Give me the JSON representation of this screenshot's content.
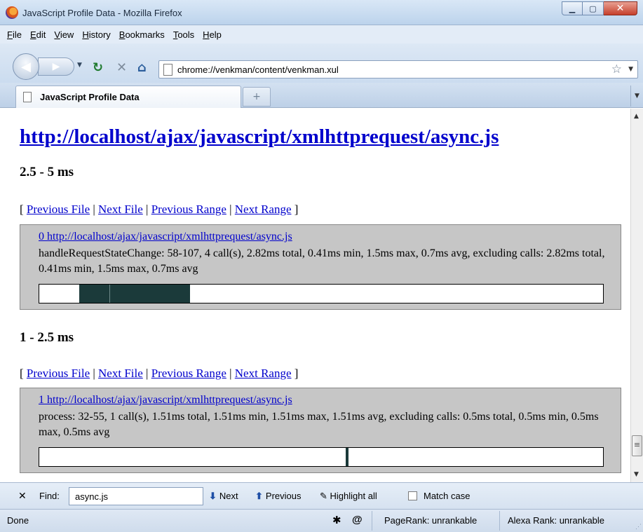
{
  "window": {
    "title": "JavaScript Profile Data - Mozilla Firefox"
  },
  "menu": [
    "File",
    "Edit",
    "View",
    "History",
    "Bookmarks",
    "Tools",
    "Help"
  ],
  "nav": {
    "url": "chrome://venkman/content/venkman.xul"
  },
  "tabs": [
    {
      "label": "JavaScript Profile Data"
    }
  ],
  "page": {
    "file_link": "http://localhost/ajax/javascript/xmlhttprequest/async.js",
    "nav_links": [
      "Previous File",
      "Next File",
      "Previous Range",
      "Next Range"
    ],
    "sections": [
      {
        "range": "2.5 - 5 ms",
        "entry_index": "0",
        "entry_link": "http://localhost/ajax/javascript/xmlhttprequest/async.js",
        "entry_text": "handleRequestStateChange: 58-107, 4 call(s), 2.82ms total, 0.41ms min, 1.5ms max, 0.7ms avg, excluding calls: 2.82ms total, 0.41ms min, 1.5ms max, 0.7ms avg",
        "bar_fill_start_fraction": 0.071,
        "bar_fill_end_fraction": 0.267
      },
      {
        "range": "1 - 2.5 ms",
        "entry_index": "1",
        "entry_link": "http://localhost/ajax/javascript/xmlhttprequest/async.js",
        "entry_text": "process: 32-55, 1 call(s), 1.51ms total, 1.51ms min, 1.51ms max, 1.51ms avg, excluding calls: 0.5ms total, 0.5ms min, 0.5ms max, 0.5ms avg",
        "bar_fill_start_fraction": 0.544,
        "bar_fill_end_fraction": 0.549
      }
    ]
  },
  "findbar": {
    "label": "Find:",
    "value": "async.js",
    "next": "Next",
    "previous": "Previous",
    "highlight": "Highlight all",
    "match_case": "Match case"
  },
  "status": {
    "text": "Done",
    "pagerank": "PageRank: unrankable",
    "alexa": "Alexa Rank: unrankable"
  }
}
